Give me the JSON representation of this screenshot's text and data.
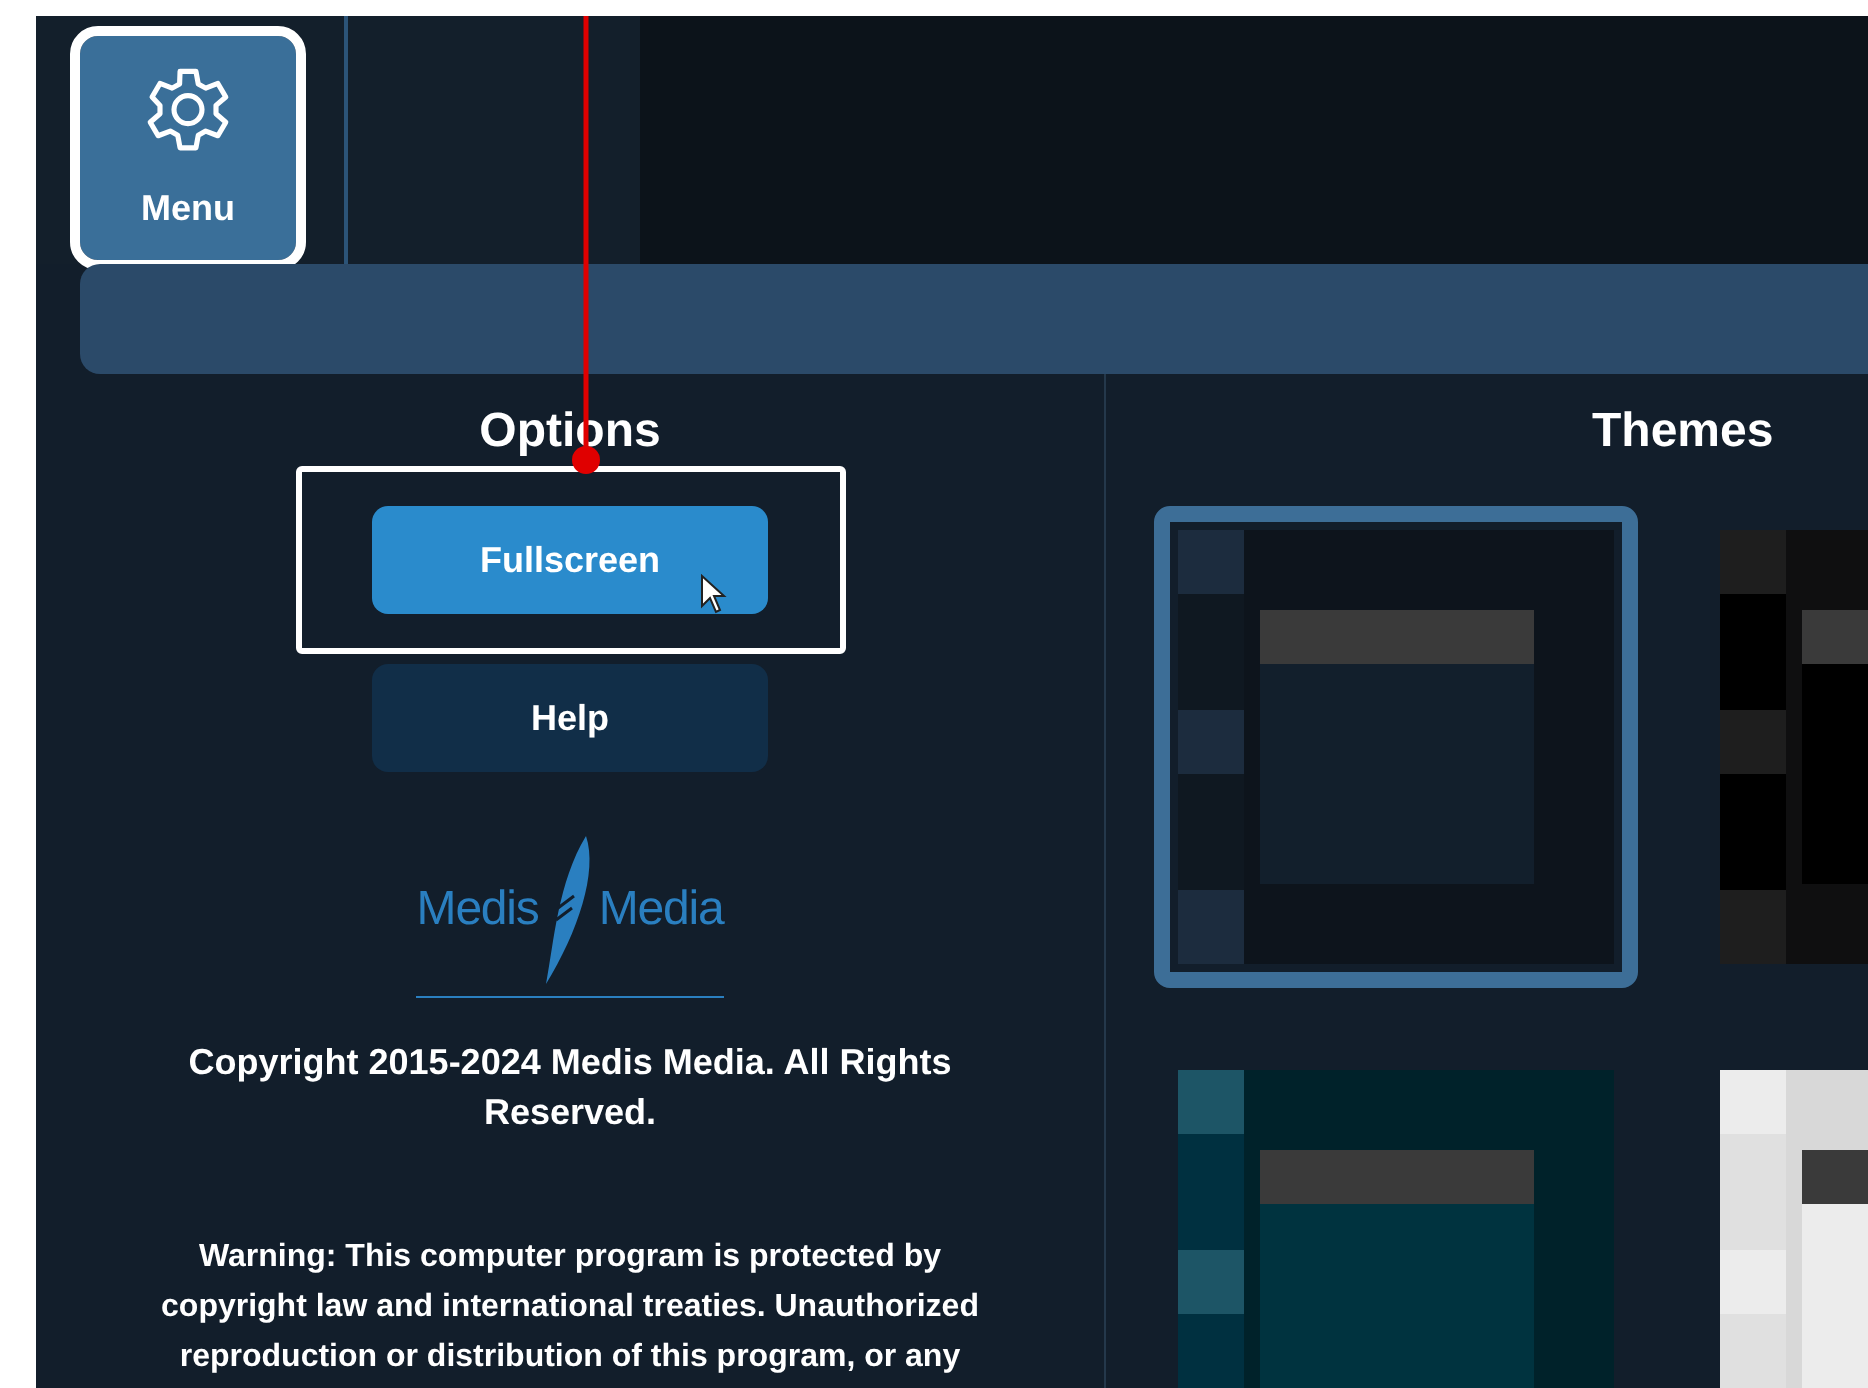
{
  "menu_button": {
    "label": "Menu",
    "highlighted": true
  },
  "options": {
    "title": "Options",
    "buttons": [
      {
        "label": "Fullscreen",
        "kind": "primary",
        "highlighted": true
      },
      {
        "label": "Help",
        "kind": "secondary",
        "highlighted": false
      }
    ]
  },
  "logo": {
    "left": "Medis",
    "right": "Media"
  },
  "copyright": "Copyright 2015-2024 Medis Media. All Rights Reserved.",
  "warning": "Warning: This computer program is protected by copyright law and international treaties. Unauthorized reproduction or distribution of this program, or any",
  "themes": {
    "title": "Themes",
    "items": [
      {
        "selected": true,
        "color": "#0d141c"
      },
      {
        "selected": false,
        "color": "#0f0f10"
      },
      {
        "selected": false,
        "color": "#00222a"
      },
      {
        "selected": false,
        "color": "#d8d8d8"
      }
    ]
  }
}
